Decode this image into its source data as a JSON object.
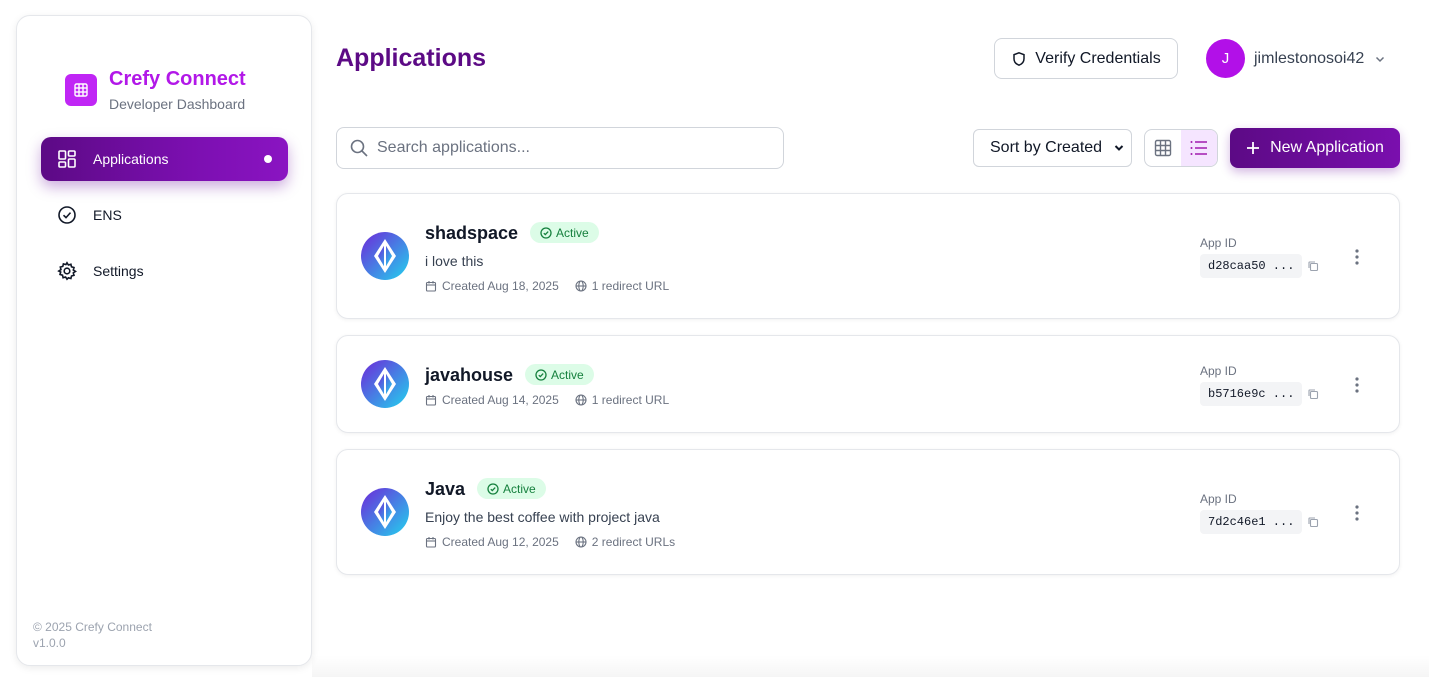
{
  "brand": {
    "name": "Crefy Connect",
    "subtitle": "Developer Dashboard",
    "accent": "#b218e8"
  },
  "sidebar": {
    "items": [
      {
        "label": "Applications",
        "icon": "dashboard-icon",
        "active": true
      },
      {
        "label": "ENS",
        "icon": "check-circle-icon",
        "active": false
      },
      {
        "label": "Settings",
        "icon": "gear-icon",
        "active": false
      }
    ],
    "footer": {
      "copyright": "© 2025 Crefy Connect",
      "version": "v1.0.0"
    }
  },
  "header": {
    "title": "Applications",
    "verify_label": "Verify Credentials",
    "user": {
      "initial": "J",
      "name": "jimlestonosoi42"
    }
  },
  "toolbar": {
    "search_placeholder": "Search applications...",
    "sort_value": "Sort by Created",
    "view_mode": "list",
    "new_label": "New Application"
  },
  "apps": [
    {
      "name": "shadspace",
      "status": "Active",
      "description": "i love this",
      "created": "Created Aug 18, 2025",
      "redirects": "1 redirect URL",
      "app_id_label": "App ID",
      "app_id": "d28caa50 ..."
    },
    {
      "name": "javahouse",
      "status": "Active",
      "description": "",
      "created": "Created Aug 14, 2025",
      "redirects": "1 redirect URL",
      "app_id_label": "App ID",
      "app_id": "b5716e9c ..."
    },
    {
      "name": "Java",
      "status": "Active",
      "description": "Enjoy the best coffee with project java",
      "created": "Created Aug 12, 2025",
      "redirects": "2 redirect URLs",
      "app_id_label": "App ID",
      "app_id": "7d2c46e1 ..."
    }
  ]
}
